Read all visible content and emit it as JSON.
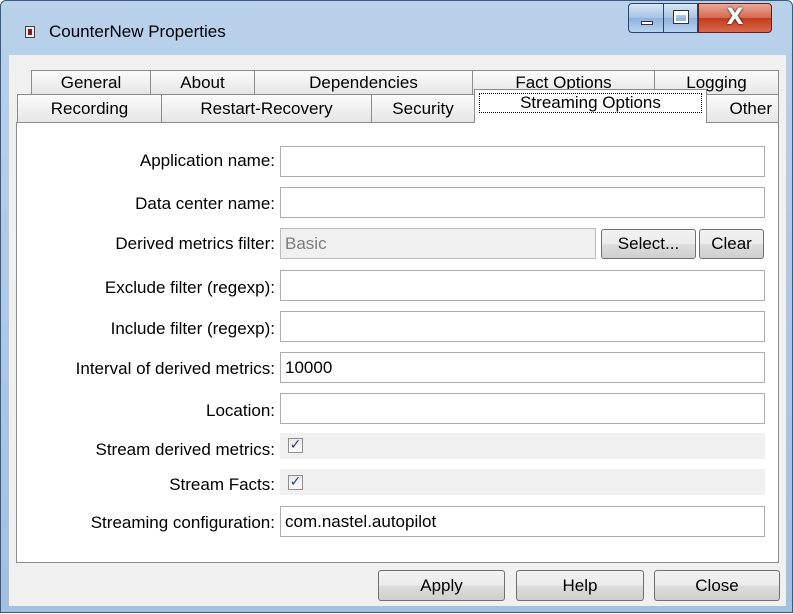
{
  "window": {
    "title": "CounterNew Properties",
    "controls": {
      "minimize": "minimize",
      "maximize": "maximize",
      "close": "X"
    }
  },
  "tabs_row1": [
    "General",
    "About",
    "Dependencies",
    "Fact Options",
    "Logging"
  ],
  "tabs_row2": [
    "Recording",
    "Restart-Recovery",
    "Security",
    "Streaming Options",
    "Other"
  ],
  "selected_tab": "Streaming Options",
  "fields": {
    "application_name": {
      "label": "Application name:",
      "value": ""
    },
    "data_center_name": {
      "label": "Data center name:",
      "value": ""
    },
    "derived_metrics_filter": {
      "label": "Derived metrics filter:",
      "value": "Basic",
      "select_label": "Select...",
      "clear_label": "Clear"
    },
    "exclude_filter": {
      "label": "Exclude filter (regexp):",
      "value": ""
    },
    "include_filter": {
      "label": "Include filter (regexp):",
      "value": ""
    },
    "interval": {
      "label": "Interval of derived metrics:",
      "value": "10000"
    },
    "location": {
      "label": "Location:",
      "value": ""
    },
    "stream_derived_metrics": {
      "label": "Stream derived metrics:",
      "checked": true,
      "mark": "✓"
    },
    "stream_facts": {
      "label": "Stream Facts:",
      "checked": true,
      "mark": "✓"
    },
    "streaming_configuration": {
      "label": "Streaming configuration:",
      "value": "com.nastel.autopilot"
    }
  },
  "buttons": {
    "apply": "Apply",
    "help": "Help",
    "close": "Close"
  },
  "colors": {
    "titlebar": "#b9d1ea",
    "close_button": "#c5391b",
    "checkmark": "#26457a"
  }
}
